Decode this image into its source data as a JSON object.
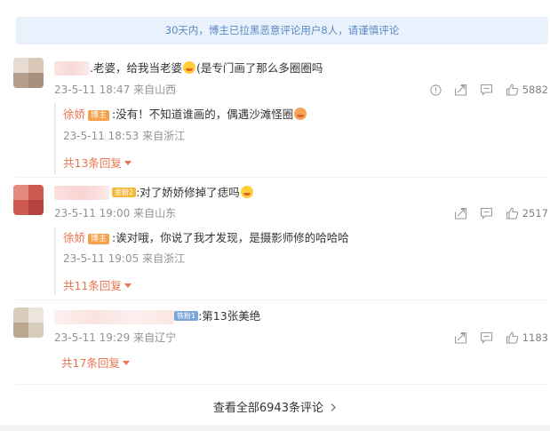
{
  "notice": "30天内，博主已拉黑恶意评论用户8人，请谨慎评论",
  "comments": [
    {
      "text": ".老婆，给我当老婆",
      "text_tail": "(是专门画了那么多圈圈吗",
      "date": "23-5-11 18:47",
      "source": "来自山西",
      "likes": "5882",
      "reply": {
        "name": "徐娇",
        "badge": "博主",
        "text": ":没有！不知道谁画的，偶遇沙滩怪圈",
        "date": "23-5-11 18:53",
        "source": "来自浙江"
      },
      "more": "共13条回复"
    },
    {
      "badge": "金粉2",
      "text": ":对了娇娇修掉了痣吗",
      "date": "23-5-11 19:00",
      "source": "来自山东",
      "likes": "2517",
      "reply": {
        "name": "徐娇",
        "badge": "博主",
        "text": ":诶对哦，你说了我才发现，是摄影师修的哈哈哈",
        "date": "23-5-11 19:05",
        "source": "来自浙江"
      },
      "more": "共11条回复"
    },
    {
      "badge": "铁粉1",
      "text": ":第13张美绝",
      "date": "23-5-11 19:29",
      "source": "来自辽宁",
      "likes": "1183",
      "more": "共17条回复"
    }
  ],
  "view_all": "查看全部6943条评论",
  "colors": {
    "accent": "#eb7350",
    "notice_bg": "#e9f2fc",
    "notice_text": "#5b8ac4",
    "meta": "#939393"
  }
}
